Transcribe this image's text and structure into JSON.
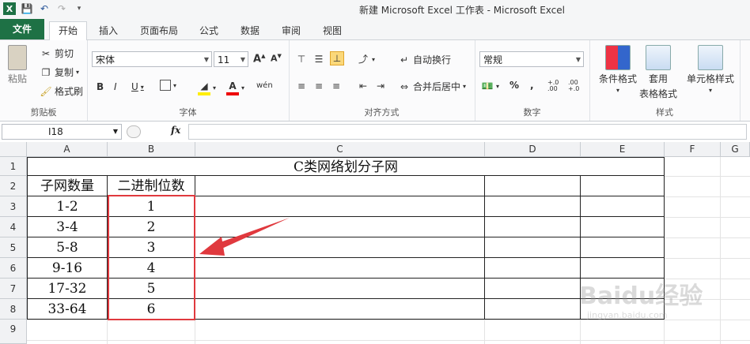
{
  "titlebar": {
    "title": "新建 Microsoft Excel 工作表 - Microsoft Excel"
  },
  "tabs": [
    "文件",
    "开始",
    "插入",
    "页面布局",
    "公式",
    "数据",
    "审阅",
    "视图"
  ],
  "ribbon": {
    "clipboard": {
      "paste": "粘贴",
      "cut": "剪切",
      "copy": "复制",
      "format_painter": "格式刷",
      "label": "剪贴板"
    },
    "font": {
      "name": "宋体",
      "size": "11",
      "label": "字体"
    },
    "alignment": {
      "wrap": "自动换行",
      "merge": "合并后居中",
      "label": "对齐方式"
    },
    "number": {
      "format": "常规",
      "percent": "%",
      "comma": ",",
      "inc": "+.0 .00",
      "dec": ".00 +.0",
      "label": "数字"
    },
    "styles": {
      "cond": "条件格式",
      "table": "套用",
      "table2": "表格格式",
      "cell": "单元格样式",
      "label": "样式"
    }
  },
  "formulabar": {
    "cell_ref": "I18",
    "fx": "fx"
  },
  "columns": [
    "A",
    "B",
    "C",
    "D",
    "E",
    "F",
    "G"
  ],
  "rows": [
    "1",
    "2",
    "3",
    "4",
    "5",
    "6",
    "7",
    "8",
    "9"
  ],
  "sheet": {
    "title": "C类网络划分子网",
    "headers": [
      "子网数量",
      "二进制位数"
    ],
    "data": [
      [
        "1-2",
        "1"
      ],
      [
        "3-4",
        "2"
      ],
      [
        "5-8",
        "3"
      ],
      [
        "9-16",
        "4"
      ],
      [
        "17-32",
        "5"
      ],
      [
        "33-64",
        "6"
      ]
    ]
  },
  "watermark": {
    "brand": "Baidu经验",
    "url": "jingyan.baidu.com"
  },
  "colors": {
    "file_tab": "#1e7145",
    "highlight_box": "#e0393e",
    "arrow": "#e0393e"
  }
}
